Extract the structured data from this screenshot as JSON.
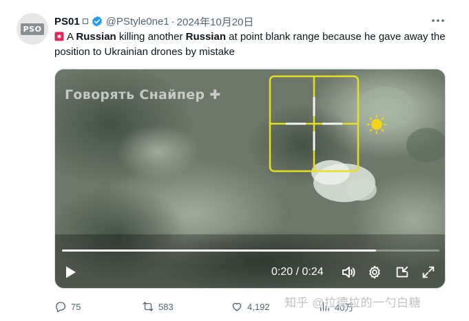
{
  "tweet": {
    "author_name": "PS01",
    "handle": "@PStyle0ne1",
    "separator": "·",
    "date": "2024年10月20日",
    "avatar_text": "PSO",
    "text_parts": {
      "p1": "A ",
      "b1": "Russian",
      "p2": " killing another ",
      "b2": "Russian",
      "p3": " at point blank range because he gave away the position to Ukrainian drones by mistake"
    }
  },
  "video": {
    "watermark": "Говорять Снайпер ✚",
    "current_time": "0:20",
    "time_separator": " / ",
    "duration": "0:24",
    "progress_fraction": 0.833
  },
  "actions": {
    "replies": "75",
    "retweets": "583",
    "likes": "4,192",
    "views": "40万"
  },
  "overlay": {
    "zhihu_watermark": "知乎 @拉德拉的一勺白糖"
  },
  "colors": {
    "text_primary": "#0f1419",
    "text_secondary": "#536471",
    "verified_blue": "#1d9bf0",
    "siren_red": "#e0245e",
    "reticle_yellow": "#e6e020"
  },
  "icons": [
    "verified-badge-icon",
    "more-icon",
    "siren-icon",
    "play-icon",
    "volume-icon",
    "settings-gear-icon",
    "pip-icon",
    "fullscreen-icon",
    "reply-icon",
    "retweet-icon",
    "like-icon",
    "views-icon"
  ]
}
